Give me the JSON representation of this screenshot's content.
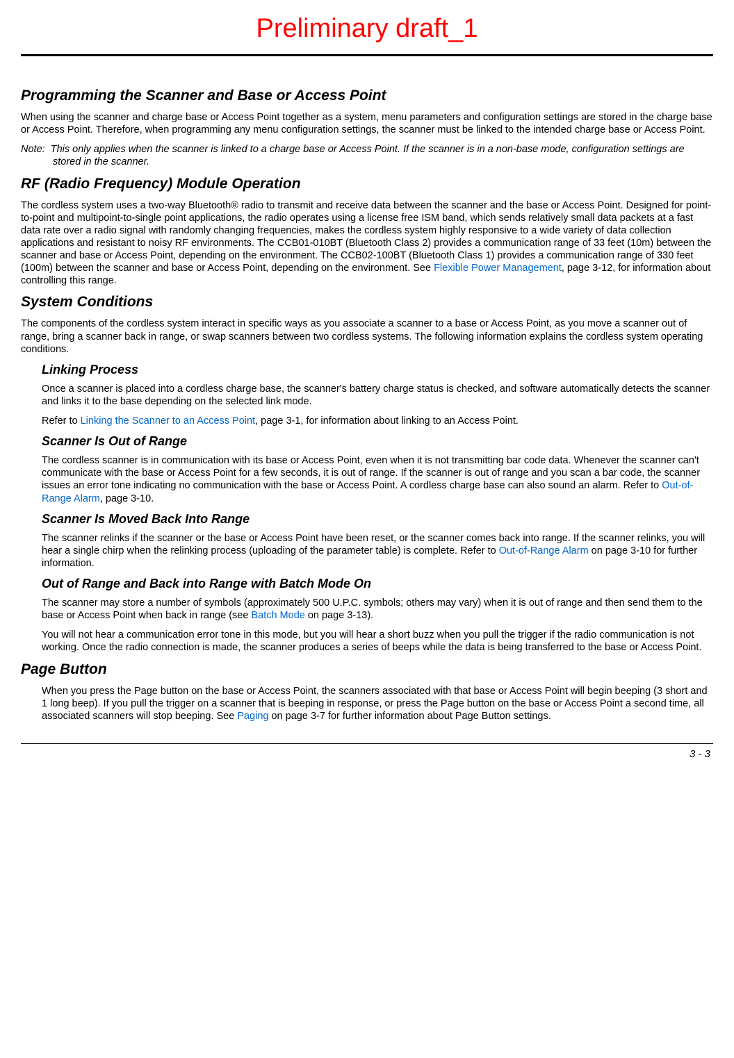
{
  "watermark": "Preliminary draft_1",
  "sections": {
    "s1": {
      "title": "Programming the Scanner and Base or Access Point",
      "p1": "When using the scanner and charge base or Access Point together as a system, menu parameters and configuration settings are stored in the charge base or Access Point.  Therefore, when programming any menu configuration settings, the scanner must be linked to the intended charge base or Access Point.",
      "note_label": "Note:",
      "note": "This only applies when the scanner is linked to a charge base or Access Point.  If the scanner is in a non-base mode, configuration settings are stored in the scanner."
    },
    "s2": {
      "title": "RF (Radio Frequency) Module Operation",
      "p1a": "The cordless system uses a two-way Bluetooth® radio to transmit and receive data between the scanner and the base or Access Point.  Designed for point-to-point and multipoint-to-single point applications, the radio operates using a license free ISM band, which sends relatively small data packets at a fast data rate over a radio signal with randomly changing frequencies, makes the cordless system highly responsive to a wide variety of data collection applications and resistant to noisy RF environments.  The CCB01-010BT (Bluetooth Class 2) provides a communication range of 33 feet (10m) between the scanner and base or Access Point, depending on the environment.  The CCB02-100BT (Bluetooth Class 1) provides a communication range of 330 feet (100m) between the scanner and base or Access Point, depending on the environment.  See ",
      "link1": "Flexible Power Management",
      "p1b": ", page 3-12, for information about controlling this range."
    },
    "s3": {
      "title": "System Conditions",
      "p1": "The components of the cordless system interact in specific ways as you associate a scanner to a base or Access Point, as you move a scanner out of range, bring a scanner back in range, or swap scanners between two cordless systems.  The following information explains the cordless system operating conditions.",
      "sub1": {
        "title": "Linking Process",
        "p1": "Once a scanner is placed into a cordless charge base, the scanner's battery charge status is checked, and software automatically detects the scanner and links it to the base depending on the selected link mode.",
        "p2a": "Refer to ",
        "link1": "Linking the Scanner to an Access Point",
        "p2b": ", page 3-1, for information about linking to an Access Point."
      },
      "sub2": {
        "title": "Scanner Is Out of Range",
        "p1a": "The cordless scanner is in communication with its base or Access Point, even when it is not transmitting bar code data.  Whenever the scanner can't communicate with the base or Access Point for a few seconds, it is out of range.  If the scanner is out of range and you scan a bar code, the scanner issues an error tone indicating no communication with the base or Access Point.  A cordless charge base can also sound an alarm.  Refer to ",
        "link1": "Out-of-Range Alarm",
        "p1b": ", page 3-10."
      },
      "sub3": {
        "title": "Scanner Is Moved Back Into Range",
        "p1a": "The scanner relinks if the scanner or the base or Access Point have been reset, or the scanner comes back into range.  If the scanner relinks, you will hear a single chirp when the relinking process (uploading of the parameter table) is complete.  Refer to ",
        "link1": "Out-of-Range Alarm",
        "p1b": " on page 3-10 for further information."
      },
      "sub4": {
        "title": "Out of Range and Back into Range with Batch Mode On",
        "p1a": "The scanner may store a number of symbols (approximately 500 U.P.C. symbols; others may vary) when it is out of range and then send them to the base or Access Point when back in range (see ",
        "link1": "Batch Mode",
        "p1b": " on page 3-13).",
        "p2": "You will not hear a communication error tone in this mode, but you will hear a short buzz when you pull the trigger if the radio communication is not working.  Once the radio connection is made, the scanner produces a series of beeps while the data is being transferred to the base or Access Point."
      }
    },
    "s4": {
      "title": "Page Button",
      "sub1": {
        "p1a": "When you press the Page button on the base or Access Point, the scanners associated with that base or Access Point will begin beeping (3 short and 1 long beep).  If you pull the trigger on a scanner that is beeping in response, or press the Page button on the base or Access Point a second time, all associated scanners will stop beeping.  See ",
        "link1": "Paging",
        "p1b": " on page 3-7 for further information about Page Button settings."
      }
    }
  },
  "footer": "3 - 3"
}
